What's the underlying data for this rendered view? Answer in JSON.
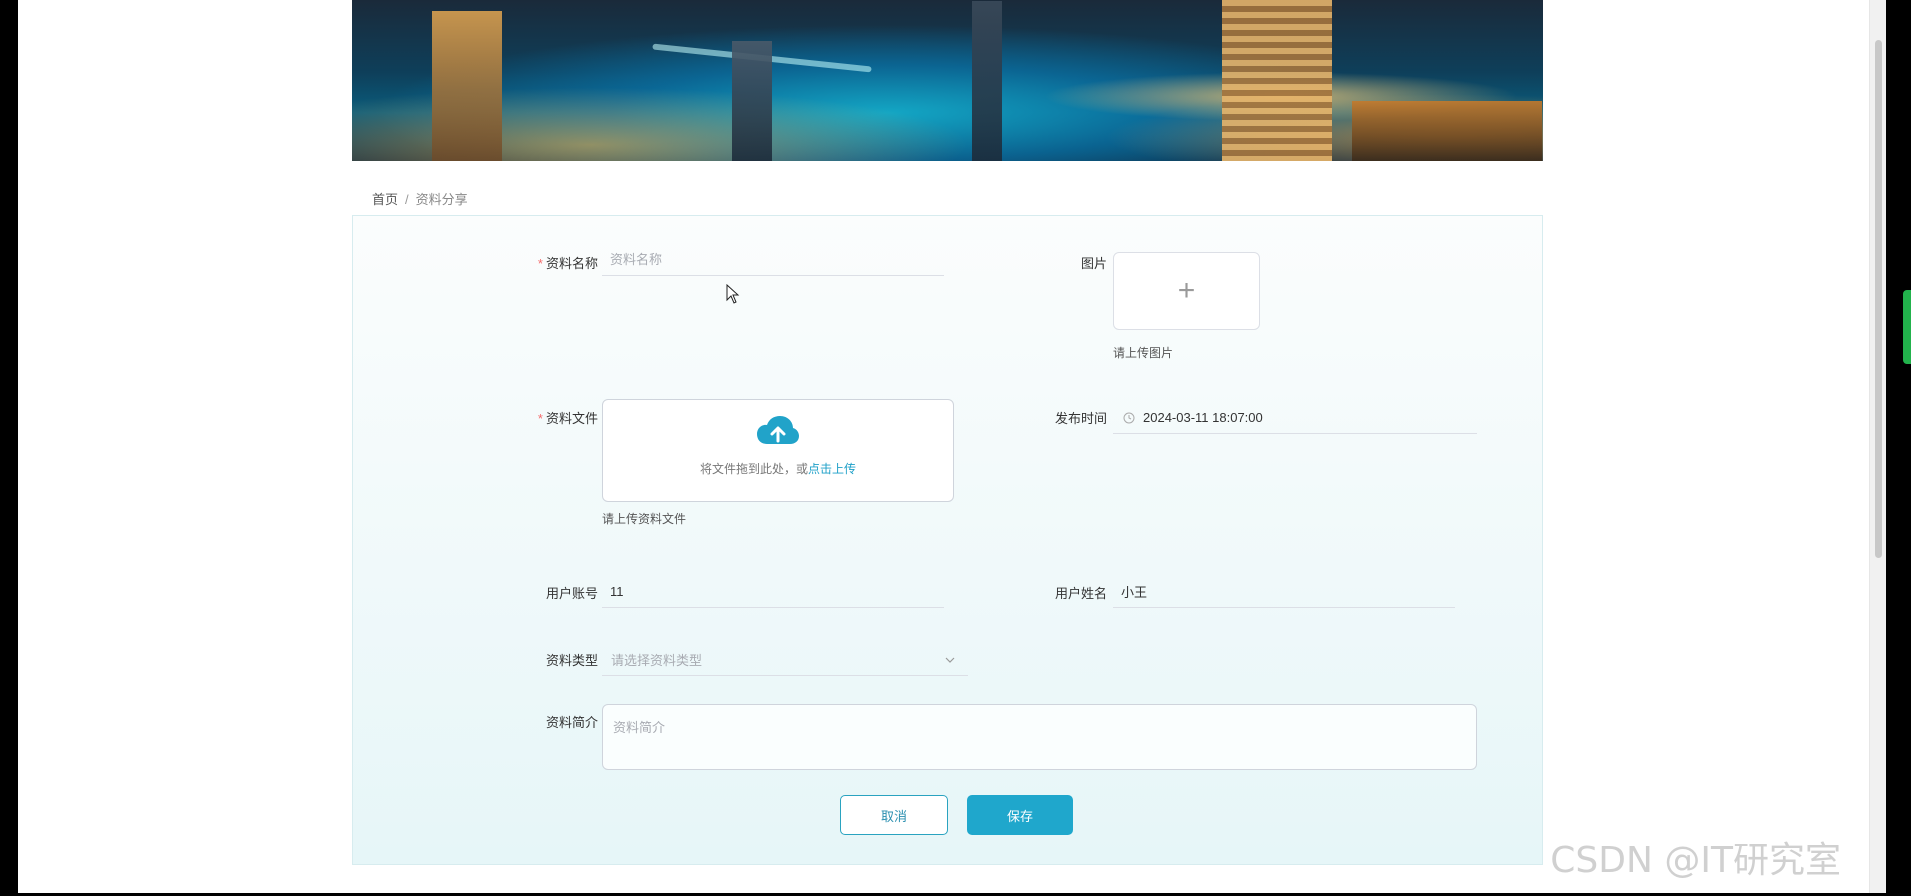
{
  "breadcrumb": {
    "home": "首页",
    "separator": "/",
    "current": "资料分享"
  },
  "form": {
    "name": {
      "label": "资料名称",
      "placeholder": "资料名称",
      "required": true
    },
    "image": {
      "label": "图片",
      "hint": "请上传图片",
      "plus": "+"
    },
    "file": {
      "label": "资料文件",
      "required": true,
      "drop_text": "将文件拖到此处，或",
      "drop_link": "点击上传",
      "hint": "请上传资料文件"
    },
    "publish_time": {
      "label": "发布时间",
      "value": "2024-03-11 18:07:00"
    },
    "user_account": {
      "label": "用户账号",
      "value": "11"
    },
    "user_name": {
      "label": "用户姓名",
      "value": "小王"
    },
    "type": {
      "label": "资料类型",
      "placeholder": "请选择资料类型"
    },
    "intro": {
      "label": "资料简介",
      "placeholder": "资料简介"
    }
  },
  "buttons": {
    "cancel": "取消",
    "save": "保存"
  },
  "watermark": "CSDN @IT研究室",
  "colors": {
    "accent": "#1fa7cc",
    "required": "#f56c6c"
  },
  "icons": [
    "cloud-upload-icon",
    "clock-icon",
    "chevron-down-icon",
    "plus-icon",
    "mouse-cursor-icon"
  ]
}
